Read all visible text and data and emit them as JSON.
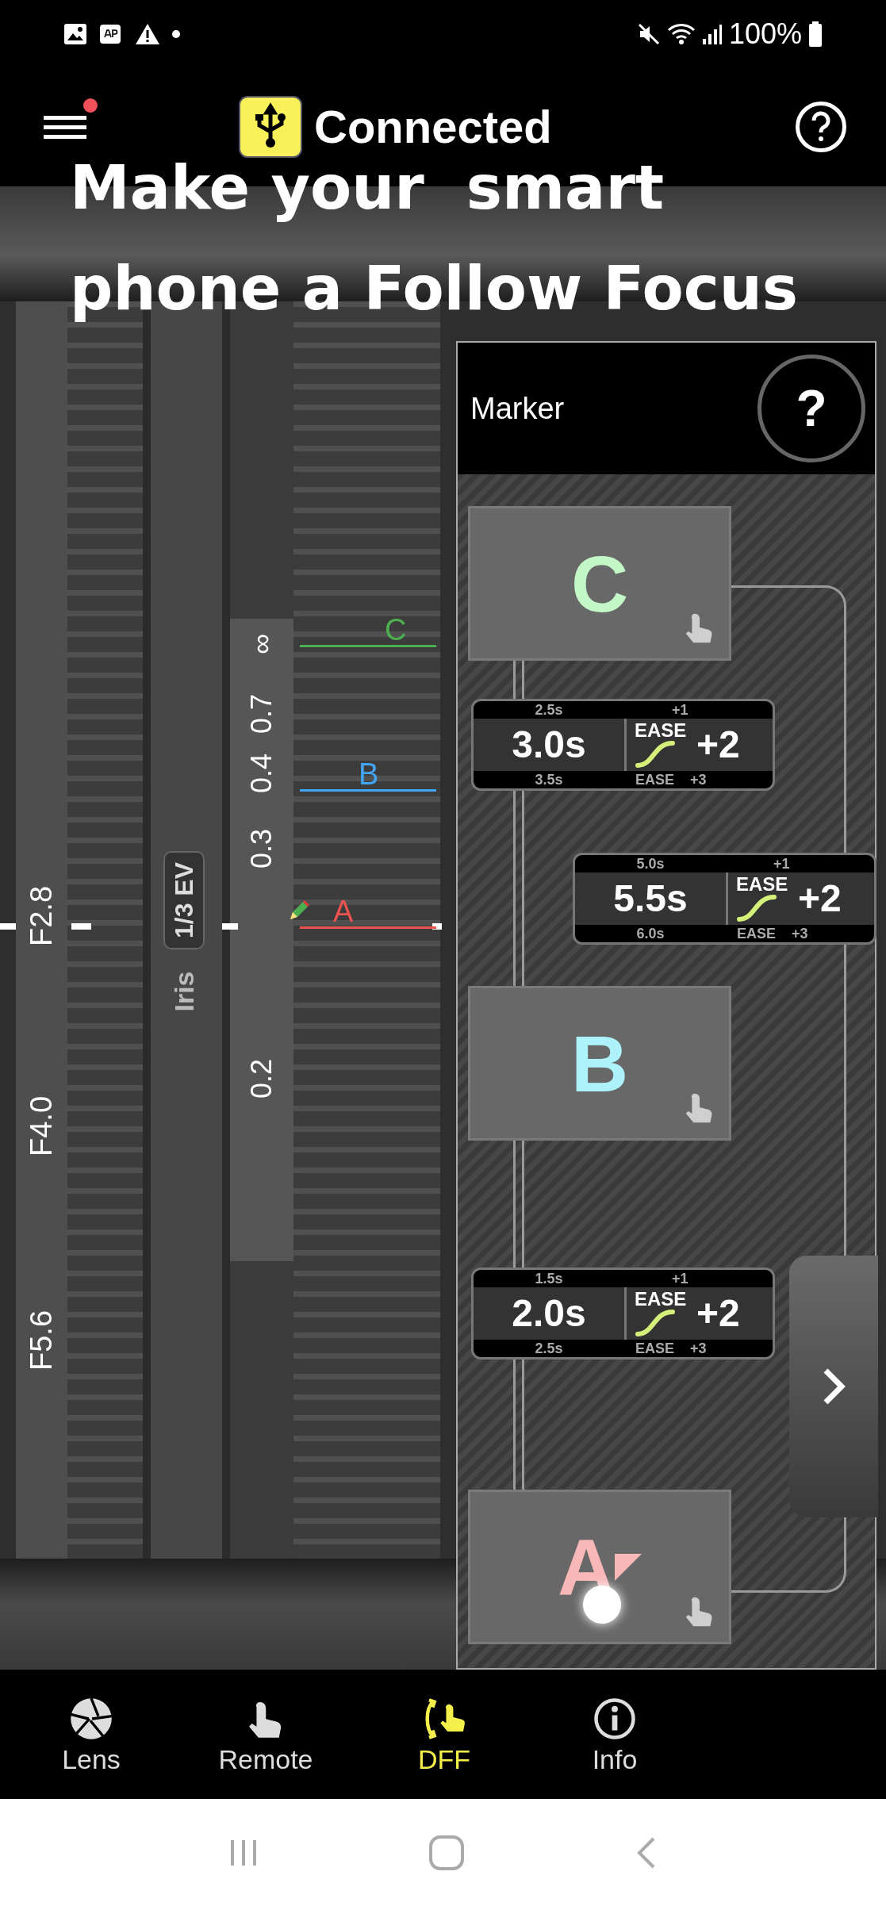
{
  "status_bar": {
    "battery": "100%"
  },
  "app_bar": {
    "menu_badge": true,
    "status": "Connected"
  },
  "headline": [
    "Make your  smart",
    "phone a Follow Focus"
  ],
  "lens": {
    "iris_scale": [
      "F2.8",
      "F4.0",
      "F5.6"
    ],
    "iris_label": "Iris",
    "step_badge": "1/3 EV",
    "focus_scale": [
      "∞",
      "0.7",
      "0.4",
      "0.3",
      "0.2"
    ],
    "markers": [
      {
        "label": "C",
        "color": "#4caf50"
      },
      {
        "label": "B",
        "color": "#42a5f5"
      },
      {
        "label": "A",
        "color": "#ef5350"
      }
    ]
  },
  "marker_panel": {
    "title": "Marker",
    "help": "?",
    "nodes": [
      {
        "kind": "marker",
        "label": "C",
        "color": "#c3f7c8",
        "selected": false
      },
      {
        "kind": "transition",
        "prev_time": "2.5s",
        "time": "3.0s",
        "next_time": "3.5s",
        "prev_ease": "+1",
        "ease_label": "EASE",
        "ease": "+2",
        "next_ease_label": "EASE",
        "next_ease": "+3"
      },
      {
        "kind": "transition",
        "prev_time": "5.0s",
        "time": "5.5s",
        "next_time": "6.0s",
        "prev_ease": "+1",
        "ease_label": "EASE",
        "ease": "+2",
        "next_ease_label": "EASE",
        "next_ease": "+3"
      },
      {
        "kind": "marker",
        "label": "B",
        "color": "#aef3fb",
        "selected": false
      },
      {
        "kind": "transition",
        "prev_time": "1.5s",
        "time": "2.0s",
        "next_time": "2.5s",
        "prev_ease": "+1",
        "ease_label": "EASE",
        "ease": "+2",
        "next_ease_label": "EASE",
        "next_ease": "+3"
      },
      {
        "kind": "marker",
        "label": "A",
        "color": "#f9b8b8",
        "selected": true
      }
    ]
  },
  "bottom_nav": [
    {
      "kind": "lens",
      "label": "Lens",
      "selected": false
    },
    {
      "kind": "remote",
      "label": "Remote",
      "selected": false
    },
    {
      "kind": "dff",
      "label": "DFF",
      "selected": true
    },
    {
      "kind": "info",
      "label": "Info",
      "selected": false
    }
  ]
}
